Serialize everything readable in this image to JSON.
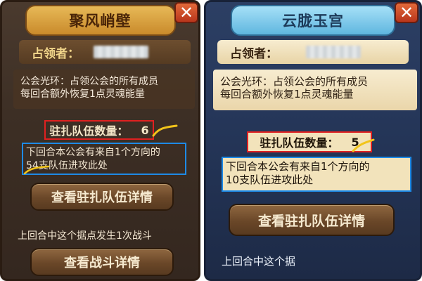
{
  "left_panel": {
    "title": "聚风峭壁",
    "occupier_label": "占领者：",
    "description_line1": "公会光环：占领公会的所有成员",
    "description_line2": "每回合额外恢复1点灵魂能量",
    "garrison_label": "驻扎队伍数量：",
    "garrison_count": "6",
    "attack_line1": "下回合本公会有来自1个方向的",
    "attack_line2": "54支队伍进攻此处",
    "garrison_detail_button": "查看驻扎队伍详情",
    "last_battle_text": "上回合中这个据点发生1次战斗",
    "battle_detail_button": "查看战斗详情",
    "close_icon": "close-x-icon"
  },
  "right_panel": {
    "title": "云胧玉宫",
    "occupier_label": "占领者：",
    "description_line1": "公会光环：占领公会的所有成员",
    "description_line2": "每回合额外恢复1点灵魂能量",
    "garrison_label": "驻扎队伍数量：",
    "garrison_count": "5",
    "attack_line1": "下回合本公会有来自1个方向的",
    "attack_line2": "10支队伍进攻此处",
    "garrison_detail_button": "查看驻扎队伍详情",
    "last_battle_text": "上回合中这个据",
    "close_icon": "close-x-icon"
  },
  "colors": {
    "highlight_red": "#e02020",
    "highlight_blue": "#1e8ae6",
    "squiggle_yellow": "#f2c41a"
  }
}
